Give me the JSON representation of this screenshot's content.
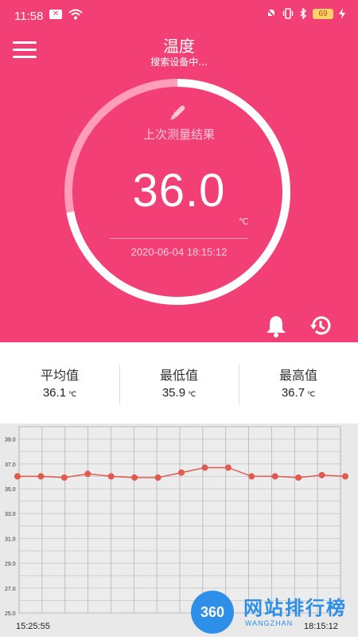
{
  "status_bar": {
    "time": "11:58",
    "battery": "69"
  },
  "header": {
    "title": "温度",
    "subtitle": "搜索设备中..."
  },
  "gauge": {
    "label": "上次测量结果",
    "value": "36.0",
    "unit": "℃",
    "datetime": "2020-06-04 18:15:12",
    "progress": 0.72
  },
  "stats": [
    {
      "label": "平均值",
      "value": "36.1",
      "unit": "℃"
    },
    {
      "label": "最低值",
      "value": "35.9",
      "unit": "℃"
    },
    {
      "label": "最高值",
      "value": "36.7",
      "unit": "℃"
    }
  ],
  "colors": {
    "accent": "#f23f76",
    "line": "#e05a4e",
    "watermark": "#2d8fe8"
  },
  "watermark": {
    "logo": "360",
    "name": "网站排行榜",
    "sub": "WANGZHAN"
  },
  "chart_data": {
    "type": "line",
    "ylim": [
      25.0,
      40.0
    ],
    "yticks": [
      "39.0",
      "37.0",
      "35.0",
      "33.0",
      "31.0",
      "29.0",
      "27.0",
      "25.0"
    ],
    "x_labels": [
      "15:25:55",
      "18:15:12"
    ],
    "series": [
      {
        "values": [
          36.0,
          36.0,
          35.9,
          36.2,
          36.0,
          35.9,
          35.9,
          36.3,
          36.7,
          36.7,
          36.0,
          36.0,
          35.9,
          36.1,
          36.0
        ]
      }
    ],
    "grid": true
  }
}
